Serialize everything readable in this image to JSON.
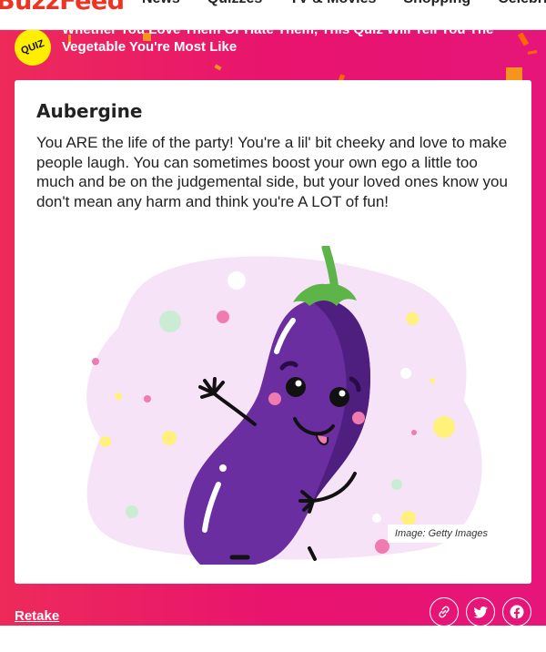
{
  "header": {
    "logo": "BuzzFeed",
    "nav": [
      "News",
      "Quizzes",
      "TV & Movies",
      "Shopping",
      "Celebrity"
    ]
  },
  "quiz": {
    "badge": "QUIZ",
    "title": "Whether You Love Them Or Hate Them, This Quiz Will Tell You The Vegetable You're Most Like"
  },
  "result": {
    "title": "Aubergine",
    "description": "You ARE the life of the party! You're a lil' bit cheeky and love to make people laugh. You can sometimes boost your own ego a little too much and be on the judgemental side, but your loved ones know you don't mean any harm and think you're A LOT of fun!",
    "image_credit": "Image: Getty Images",
    "image_subject": "cartoon-aubergine-illustration"
  },
  "actions": {
    "retake_label": "Retake",
    "share_icons": [
      "link-icon",
      "twitter-icon",
      "facebook-icon"
    ]
  },
  "colors": {
    "brand_red": "#ee3322",
    "hero_pink": "#e8146e",
    "quiz_yellow": "#ffee00",
    "aubergine_purple": "#6a2ea0"
  }
}
